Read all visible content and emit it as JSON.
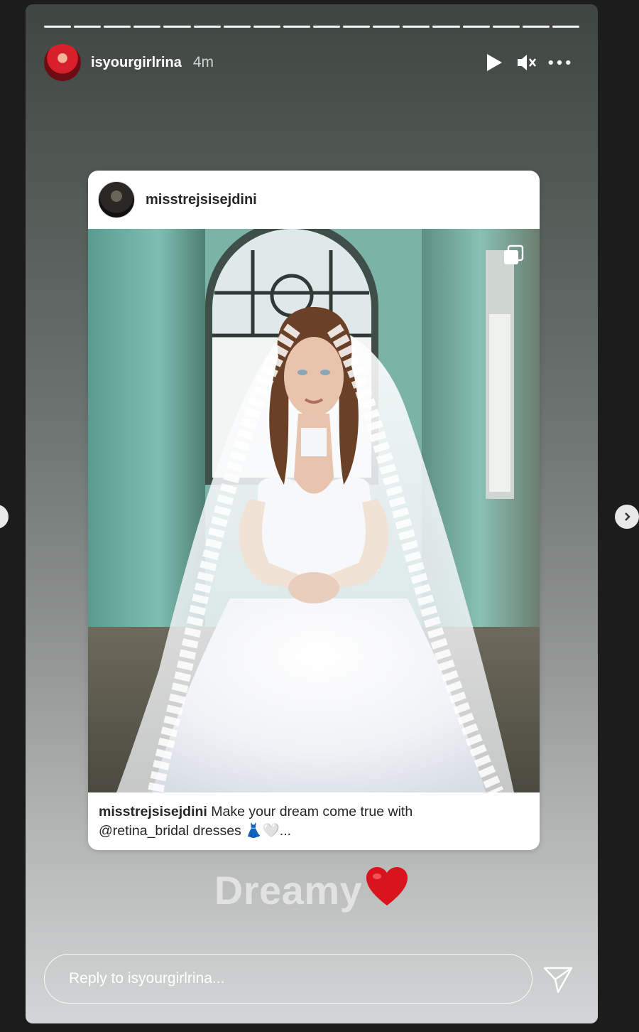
{
  "story": {
    "username": "isyourgirlrina",
    "time_ago": "4m",
    "progress_segments": 18,
    "controls": {
      "play_icon": "play-icon",
      "mute_icon": "muted-speaker-icon",
      "more_icon": "more-horizontal-icon"
    }
  },
  "post": {
    "username": "misstrejsisejdini",
    "caption_user": "misstrejsisejdini",
    "caption_text": " Make your dream come true with",
    "caption_line2": "@retina_bridal dresses 👗🤍...",
    "multi_icon": "carousel-icon"
  },
  "sticker": {
    "text": "Dreamy",
    "emoji": "❤️"
  },
  "reply": {
    "placeholder": "Reply to isyourgirlrina..."
  },
  "nav": {
    "prev_icon": "chevron-left-icon",
    "next_icon": "chevron-right-icon",
    "send_icon": "paper-plane-icon"
  },
  "colors": {
    "page_bg": "#1c1c1c",
    "sticker_text": "#e2e2e2",
    "heart": "#d8141c"
  }
}
